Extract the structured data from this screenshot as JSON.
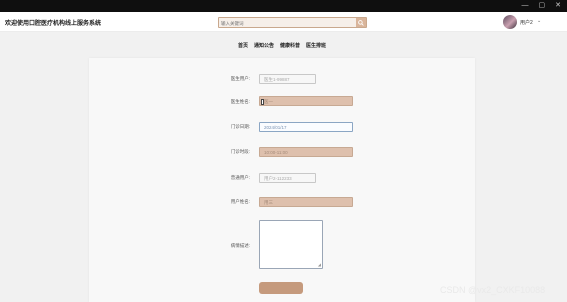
{
  "window": {
    "minimize_glyph": "—",
    "maximize_glyph": "▢",
    "close_glyph": "✕"
  },
  "header": {
    "site_title": "欢迎使用口腔医疗机构线上服务系统",
    "search": {
      "placeholder": "输入关键词",
      "icon": "search-icon"
    },
    "user": {
      "name": "用户2",
      "caret": "⌄"
    }
  },
  "nav": {
    "items": [
      {
        "label": "首页"
      },
      {
        "label": "通知公告"
      },
      {
        "label": "健康科普"
      },
      {
        "label": "医生排班"
      }
    ]
  },
  "form": {
    "doctor_account": {
      "label": "医生用户:",
      "value": "医生1-99887"
    },
    "doctor_name": {
      "label": "医生姓名:",
      "value": "医一"
    },
    "clinic_date": {
      "label": "门诊日期:",
      "value": "2024/01/17"
    },
    "clinic_time": {
      "label": "门诊时段:",
      "value": "10:00-11:00"
    },
    "user_account": {
      "label": "普通用户:",
      "value": "用户2-112233"
    },
    "user_name": {
      "label": "用户姓名:",
      "value": "用三"
    },
    "description": {
      "label": "病情描述:",
      "value": ""
    },
    "submit_label": ""
  },
  "watermark": "CSDN @vx2_CXKF10088",
  "colors": {
    "accent": "#c59a7d",
    "field_tan": "#dec0ad",
    "date_border": "#8ba6c4"
  }
}
